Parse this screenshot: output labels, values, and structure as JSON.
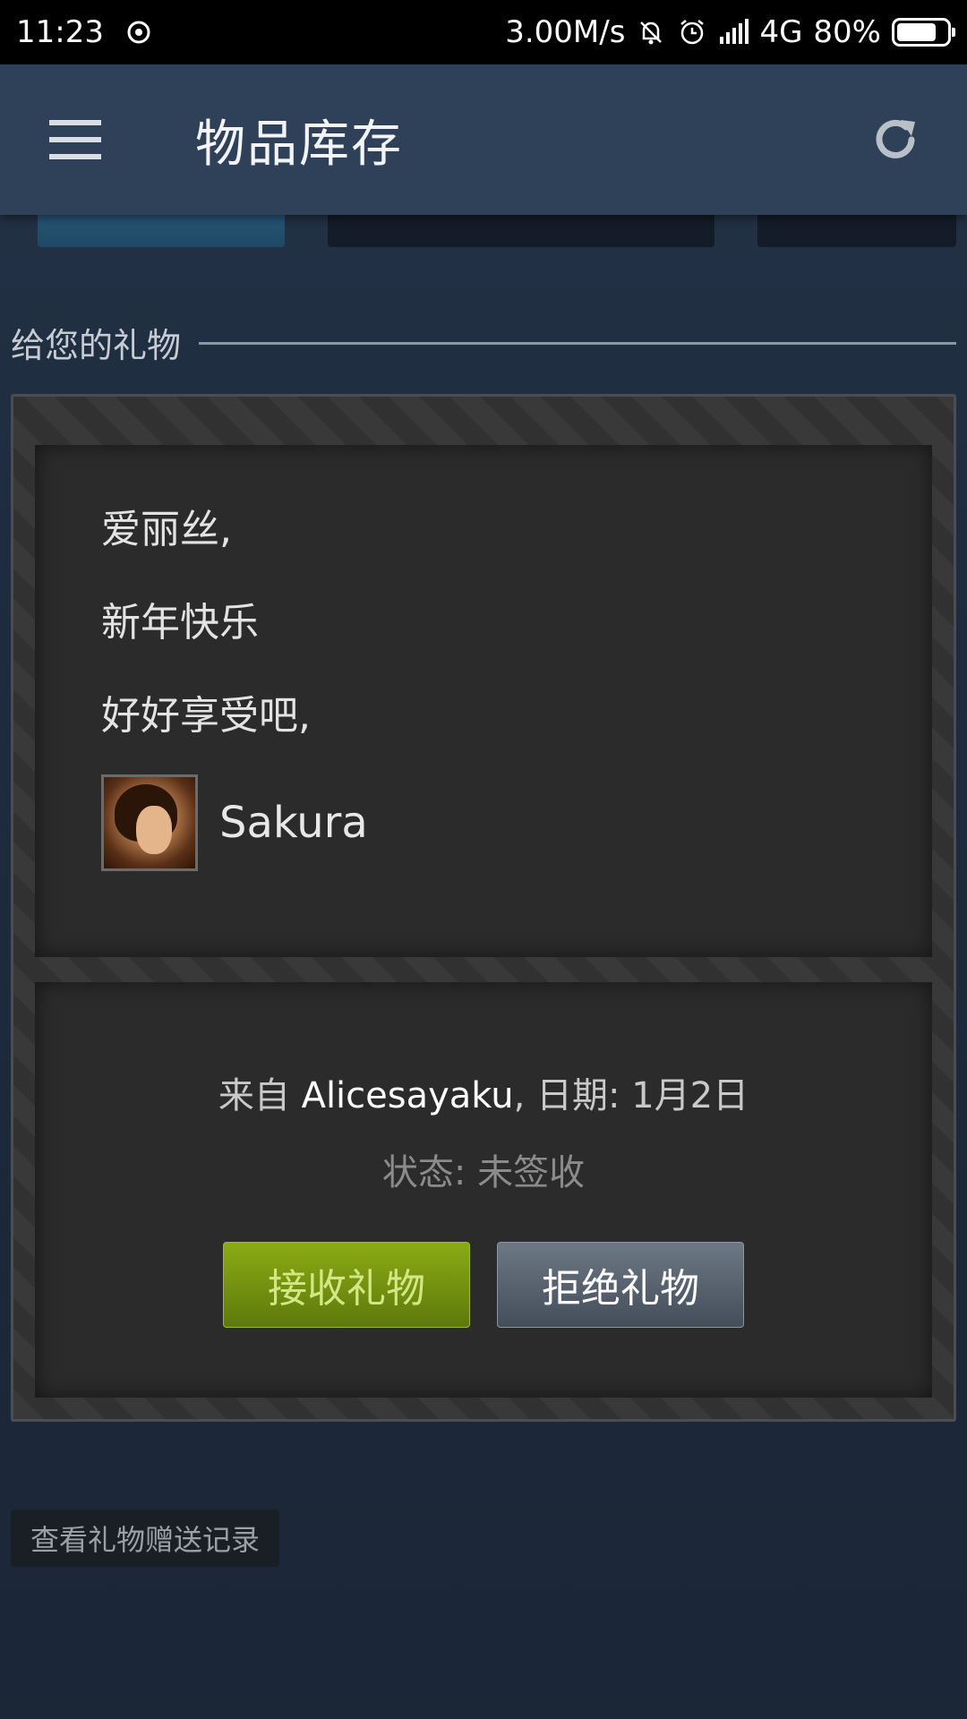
{
  "status_bar": {
    "time": "11:23",
    "network_speed": "3.00M/s",
    "network_type": "4G",
    "battery": "80%",
    "battery_level": 0.8
  },
  "app_bar": {
    "title": "物品库存",
    "menu_icon": "hamburger-menu-icon",
    "refresh_icon": "refresh-icon"
  },
  "section": {
    "title": "给您的礼物"
  },
  "gift": {
    "message_lines": [
      "爱丽丝,",
      "新年快乐",
      "好好享受吧,"
    ],
    "sender": "Sakura",
    "from_prefix": "来自 ",
    "from_name": "Alicesayaku",
    "date_text": ", 日期: 1月2日",
    "status": "状态: 未签收",
    "accept_label": "接收礼物",
    "decline_label": "拒绝礼物"
  },
  "history_label": "查看礼物赠送记录",
  "colors": {
    "app_bar": "#2f4158",
    "background": "#1b2637",
    "accept_green": "#7ea012",
    "decline_gray": "#5a6470",
    "link_blue": "#67c1f5"
  }
}
